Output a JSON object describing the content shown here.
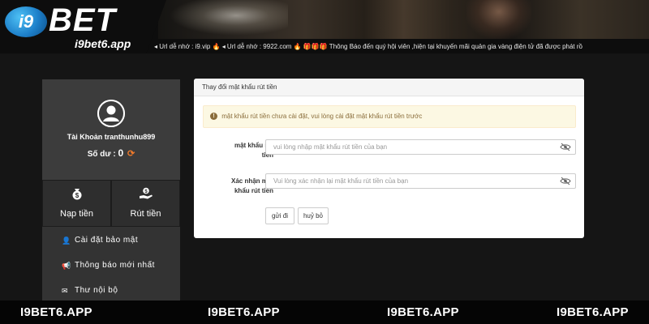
{
  "header": {
    "logo_badge": "i9",
    "logo_text": "BET",
    "logo_domain": "i9bet6.app",
    "ticker": "◂ Url dễ nhớ : i9.vip 🔥 ◂ Url dễ nhớ : 9922.com 🔥 🎁🎁🎁 Thông Báo đến quý hội viên ,hiện tại khuyến mãi quản gia vàng điện tử đã được phát rồ"
  },
  "profile": {
    "account_label": "Tài Khoản",
    "account_name": "tranthunhu899",
    "balance_label": "Số dư :",
    "balance_value": "0"
  },
  "actions": {
    "deposit_label": "Nạp tiền",
    "withdraw_label": "Rút tiền"
  },
  "menu": {
    "items": [
      {
        "label": "Cài đặt bảo mật",
        "icon": "user-cog-icon"
      },
      {
        "label": "Thông báo mới nhất",
        "icon": "megaphone-icon"
      },
      {
        "label": "Thư nội bộ",
        "icon": "envelope-icon"
      }
    ]
  },
  "panel": {
    "title": "Thay đổi mật khẩu rút tiền",
    "alert": "mật khẩu rút tiền chưa cài đặt, vui lòng cài đặt mật khẩu rút tiền trước",
    "field1_label_1": "mật khẩu rút",
    "field1_label_2": "tiền",
    "field1_placeholder": "vui lòng nhập mật khẩu rút tiền của bạn",
    "field2_label_1": "Xác nhận mật",
    "field2_label_2": "khẩu rút tiền",
    "field2_placeholder": "Vui lòng xác nhận lại mật khẩu rút tiền của bạn",
    "submit_label": "gửi đi",
    "cancel_label": "huỷ bỏ"
  },
  "footer": {
    "watermark": "I9BET6.APP"
  },
  "colors": {
    "page_bg": "#151515",
    "card_bg": "#3c3c3c",
    "alert_bg": "#fcf8e3",
    "alert_text": "#8a6d3b",
    "refresh_accent": "#f07a2a"
  }
}
